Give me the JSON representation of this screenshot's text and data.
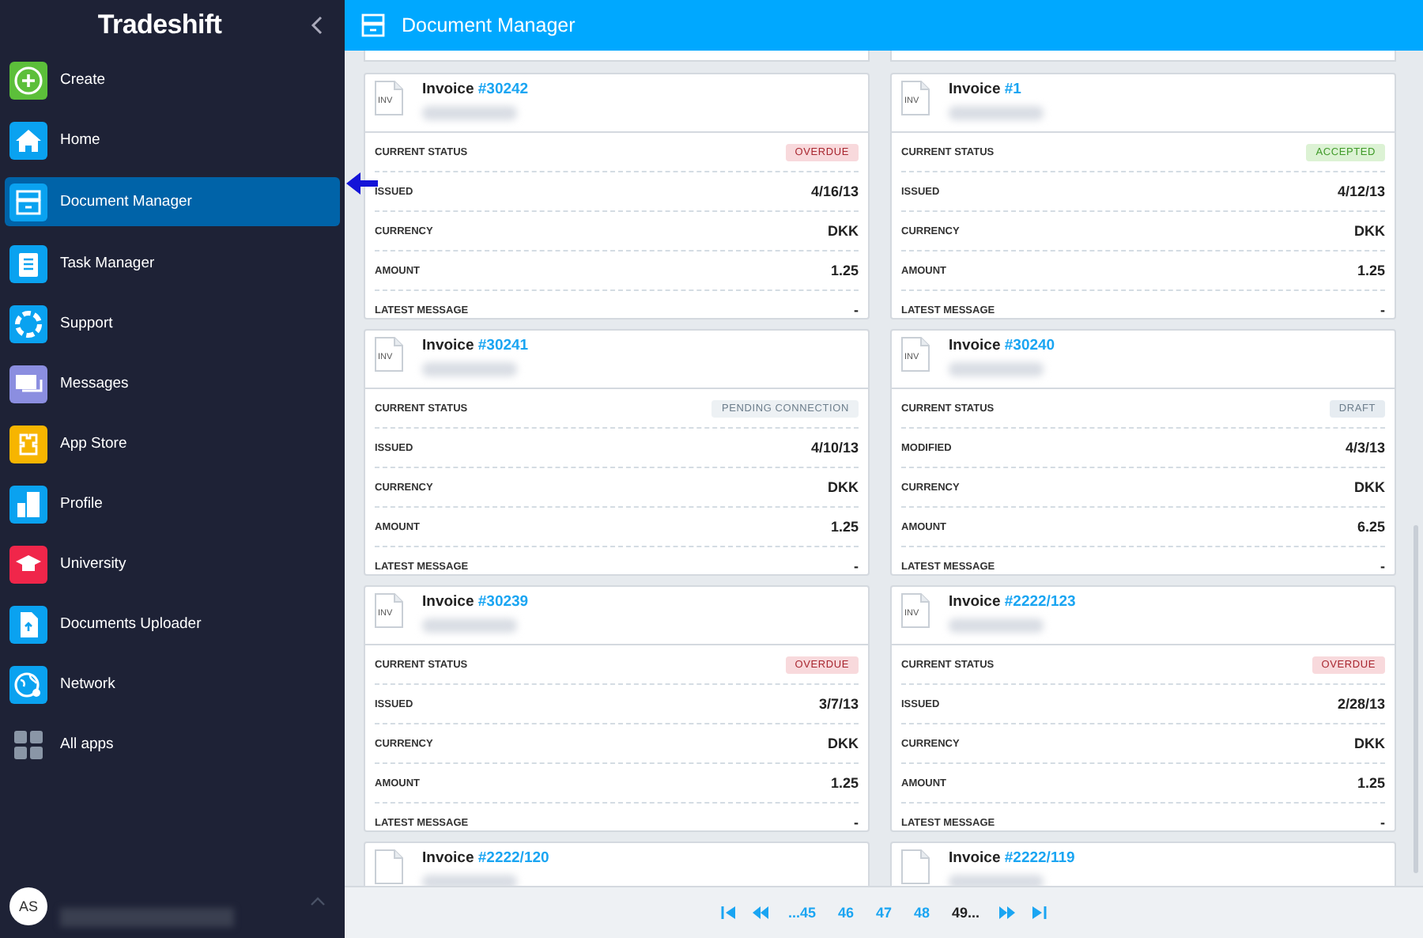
{
  "sidebar": {
    "logo": "Tradeshift",
    "items": [
      {
        "label": "Create",
        "color": "#5cbf3a",
        "selected": false
      },
      {
        "label": "Home",
        "color": "#0aa2f0",
        "selected": false
      },
      {
        "label": "Document Manager",
        "color": "#0aa2f0",
        "selected": true
      },
      {
        "label": "Task Manager",
        "color": "#0aa2f0",
        "selected": false
      },
      {
        "label": "Support",
        "color": "#0aa2f0",
        "selected": false
      },
      {
        "label": "Messages",
        "color": "#8b8ee0",
        "selected": false
      },
      {
        "label": "App Store",
        "color": "#f7b500",
        "selected": false
      },
      {
        "label": "Profile",
        "color": "#0aa2f0",
        "selected": false
      },
      {
        "label": "University",
        "color": "#f0264a",
        "selected": false
      },
      {
        "label": "Documents Uploader",
        "color": "#0aa2f0",
        "selected": false
      },
      {
        "label": "Network",
        "color": "#0aa2f0",
        "selected": false
      },
      {
        "label": "All apps",
        "color": "#8a96a6",
        "selected": false
      }
    ],
    "user": {
      "initials": "AS"
    }
  },
  "header": {
    "title": "Document Manager"
  },
  "cards": [
    {
      "type": "Invoice",
      "number": "#30242",
      "badge": "INV",
      "status_label": "CURRENT STATUS",
      "status": {
        "label": "OVERDUE",
        "kind": "overdue"
      },
      "rows": [
        {
          "label": "ISSUED",
          "value": "4/16/13"
        },
        {
          "label": "CURRENCY",
          "value": "DKK"
        },
        {
          "label": "AMOUNT",
          "value": "1.25"
        },
        {
          "label": "LATEST MESSAGE",
          "value": "-"
        }
      ]
    },
    {
      "type": "Invoice",
      "number": "#1",
      "badge": "INV",
      "status_label": "CURRENT STATUS",
      "status": {
        "label": "ACCEPTED",
        "kind": "accepted"
      },
      "rows": [
        {
          "label": "ISSUED",
          "value": "4/12/13"
        },
        {
          "label": "CURRENCY",
          "value": "DKK"
        },
        {
          "label": "AMOUNT",
          "value": "1.25"
        },
        {
          "label": "LATEST MESSAGE",
          "value": "-"
        }
      ]
    },
    {
      "type": "Invoice",
      "number": "#30241",
      "badge": "INV",
      "status_label": "CURRENT STATUS",
      "status": {
        "label": "PENDING CONNECTION",
        "kind": "pending"
      },
      "rows": [
        {
          "label": "ISSUED",
          "value": "4/10/13"
        },
        {
          "label": "CURRENCY",
          "value": "DKK"
        },
        {
          "label": "AMOUNT",
          "value": "1.25"
        },
        {
          "label": "LATEST MESSAGE",
          "value": "-"
        }
      ]
    },
    {
      "type": "Invoice",
      "number": "#30240",
      "badge": "INV",
      "status_label": "CURRENT STATUS",
      "status": {
        "label": "DRAFT",
        "kind": "draft"
      },
      "rows": [
        {
          "label": "MODIFIED",
          "value": "4/3/13"
        },
        {
          "label": "CURRENCY",
          "value": "DKK"
        },
        {
          "label": "AMOUNT",
          "value": "6.25"
        },
        {
          "label": "LATEST MESSAGE",
          "value": "-"
        }
      ]
    },
    {
      "type": "Invoice",
      "number": "#30239",
      "badge": "INV",
      "status_label": "CURRENT STATUS",
      "status": {
        "label": "OVERDUE",
        "kind": "overdue"
      },
      "rows": [
        {
          "label": "ISSUED",
          "value": "3/7/13"
        },
        {
          "label": "CURRENCY",
          "value": "DKK"
        },
        {
          "label": "AMOUNT",
          "value": "1.25"
        },
        {
          "label": "LATEST MESSAGE",
          "value": "-"
        }
      ]
    },
    {
      "type": "Invoice",
      "number": "#2222/123",
      "badge": "INV",
      "status_label": "CURRENT STATUS",
      "status": {
        "label": "OVERDUE",
        "kind": "overdue"
      },
      "rows": [
        {
          "label": "ISSUED",
          "value": "2/28/13"
        },
        {
          "label": "CURRENCY",
          "value": "DKK"
        },
        {
          "label": "AMOUNT",
          "value": "1.25"
        },
        {
          "label": "LATEST MESSAGE",
          "value": "-"
        }
      ]
    },
    {
      "type": "Invoice",
      "number": "#2222/120"
    },
    {
      "type": "Invoice",
      "number": "#2222/119"
    }
  ],
  "pagination": {
    "pages": [
      {
        "label": "...45",
        "selected": false
      },
      {
        "label": "46",
        "selected": false
      },
      {
        "label": "47",
        "selected": false
      },
      {
        "label": "48",
        "selected": false
      },
      {
        "label": "49...",
        "selected": true
      }
    ]
  }
}
